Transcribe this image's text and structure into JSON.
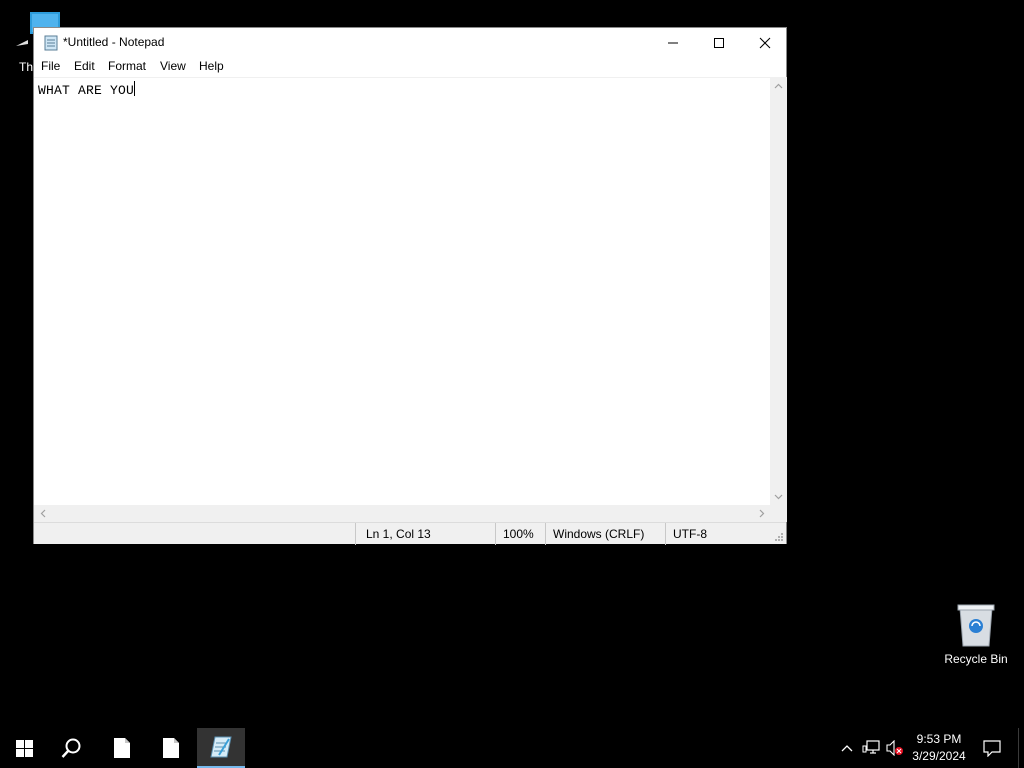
{
  "desktop": {
    "thispc_label": "Th",
    "recycle_label": "Recycle Bin"
  },
  "notepad": {
    "title": "*Untitled - Notepad",
    "menu": [
      "File",
      "Edit",
      "Format",
      "View",
      "Help"
    ],
    "content": "WHAT ARE YOU",
    "status": {
      "position": "Ln 1, Col 13",
      "zoom": "100%",
      "line_ending": "Windows (CRLF)",
      "encoding": "UTF-8"
    }
  },
  "taskbar": {
    "time": "9:53 PM",
    "date": "3/29/2024",
    "active_app": "notepad",
    "accent_color": "#76b9ed"
  },
  "icons": {
    "start": "windows-logo-icon",
    "search": "search-icon",
    "pinned_1": "file-icon",
    "pinned_2": "file-icon",
    "notepad": "notepad-icon",
    "tray_chevron": "chevron-up-icon",
    "network": "network-icon",
    "volume": "volume-muted-icon",
    "notifications": "notification-icon"
  }
}
